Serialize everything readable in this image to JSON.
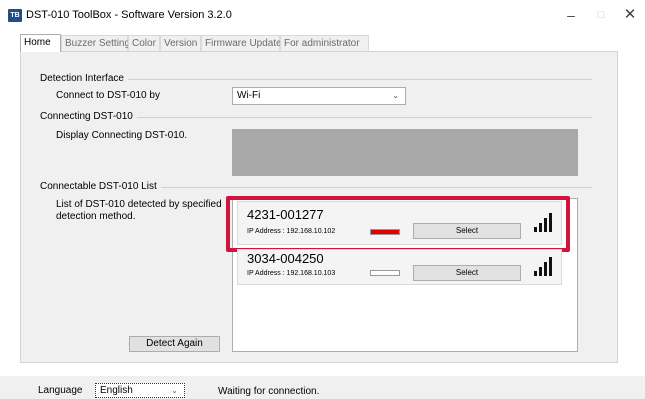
{
  "window": {
    "title": "DST-010 ToolBox - Software Version 3.2.0",
    "icon_label": "ToolBox",
    "minimize_glyph": "–",
    "maximize_glyph": "□",
    "close_glyph": "✕"
  },
  "tabs": [
    {
      "label": "Home"
    },
    {
      "label": "Buzzer Setting"
    },
    {
      "label": "Color"
    },
    {
      "label": "Version"
    },
    {
      "label": "Firmware Update"
    },
    {
      "label": "For administrator"
    }
  ],
  "detection_interface": {
    "group_label": "Detection Interface",
    "connect_label": "Connect to DST-010 by",
    "connect_value": "Wi-Fi"
  },
  "connecting": {
    "group_label": "Connecting DST-010",
    "description": "Display Connecting DST-010."
  },
  "connectable": {
    "group_label": "Connectable DST-010 List",
    "description_line1": "List of DST-010 detected by specified",
    "description_line2": "detection method.",
    "detect_again_label": "Detect Again",
    "devices": [
      {
        "id": "4231-001277",
        "ip": "IP Address : 192.168.10.102",
        "select_label": "Select",
        "indicator_color": "#e00000",
        "signal_bars": 4
      },
      {
        "id": "3034-004250",
        "ip": "IP Address : 192.168.10.103",
        "select_label": "Select",
        "indicator_color": "#ffffff",
        "signal_bars": 4
      }
    ]
  },
  "statusbar": {
    "language_label": "Language",
    "language_value": "English",
    "status_text": "Waiting for connection."
  },
  "colors": {
    "highlight": "#d0143c",
    "panel": "#f0f0f0",
    "connecting_area": "#a8a8a8"
  },
  "icons": {
    "app": "app-icon",
    "signal": "signal-strength-icon",
    "dropdown": "chevron-down-icon"
  }
}
